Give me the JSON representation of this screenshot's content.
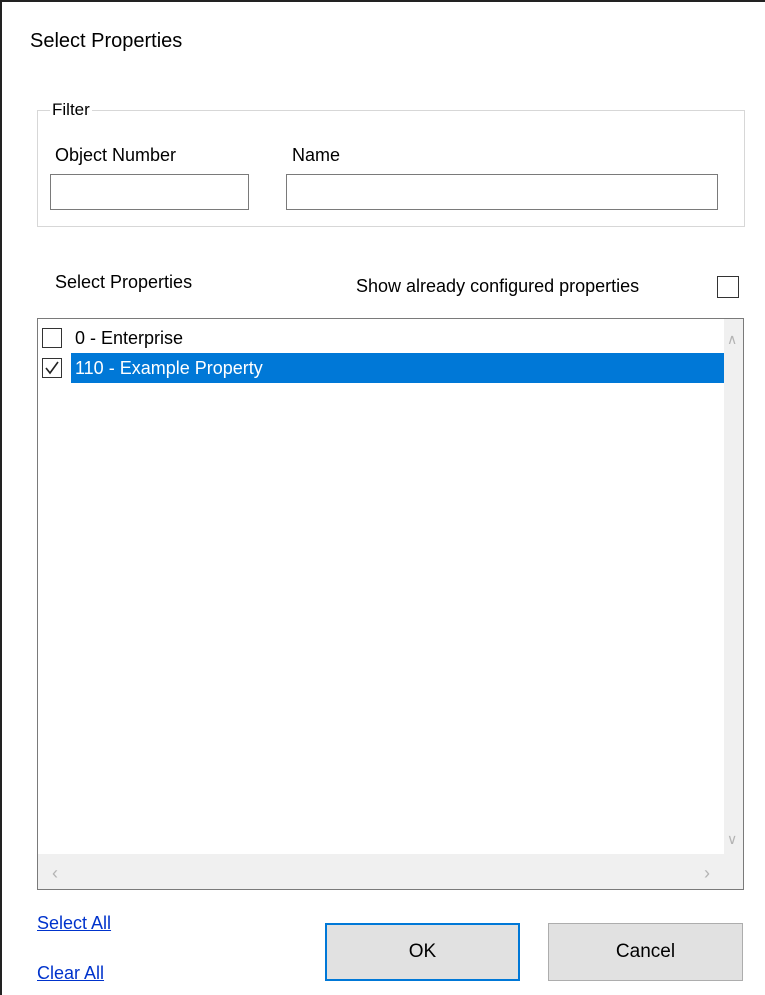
{
  "dialog": {
    "title": "Select Properties"
  },
  "filter": {
    "legend": "Filter",
    "object_number_label": "Object Number",
    "object_number_value": "",
    "name_label": "Name",
    "name_value": ""
  },
  "select_section": {
    "label": "Select Properties",
    "show_configured_label": "Show already configured properties",
    "show_configured_checked": false
  },
  "properties": [
    {
      "label": "0 - Enterprise",
      "checked": false,
      "selected": false
    },
    {
      "label": "110 - Example Property",
      "checked": true,
      "selected": true
    }
  ],
  "scrollbars": {
    "up_icon": "chevron-up-icon",
    "down_icon": "chevron-down-icon",
    "left_icon": "chevron-left-icon",
    "right_icon": "chevron-right-icon"
  },
  "links": {
    "select_all": "Select All",
    "clear_all": "Clear All"
  },
  "buttons": {
    "ok": "OK",
    "cancel": "Cancel"
  },
  "colors": {
    "selection": "#0078d7",
    "link": "#0033cc",
    "button_face": "#e1e1e1"
  }
}
